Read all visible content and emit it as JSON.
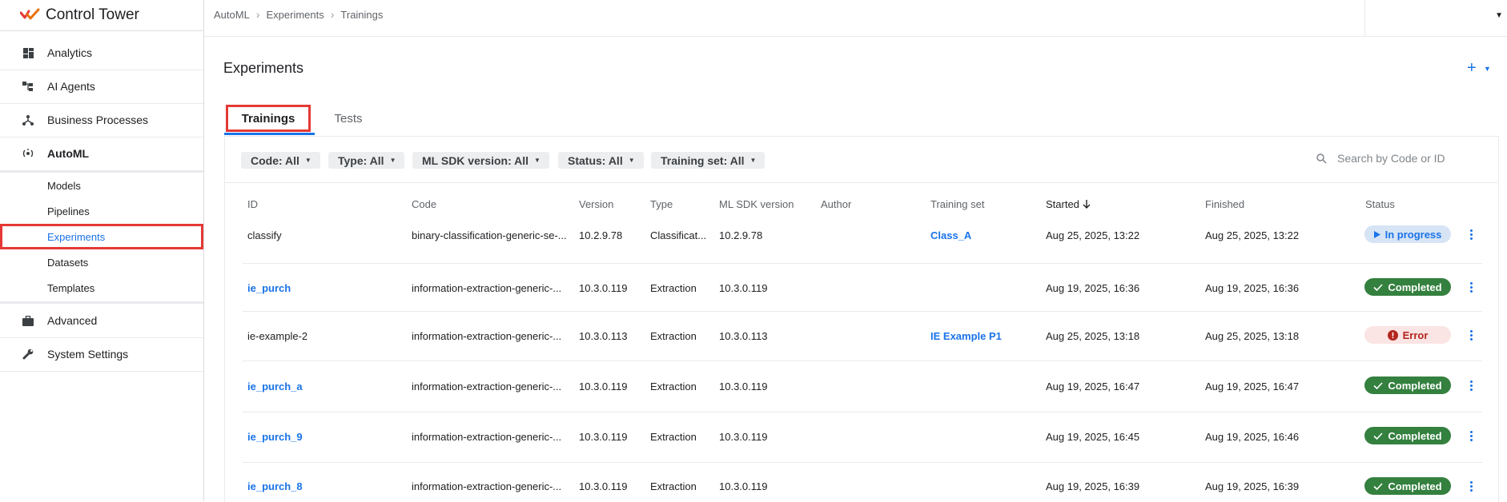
{
  "app": {
    "title": "Control Tower"
  },
  "sidebar": {
    "items": [
      {
        "label": "Analytics",
        "icon": "dashboard-icon"
      },
      {
        "label": "AI Agents",
        "icon": "agents-icon"
      },
      {
        "label": "Business Processes",
        "icon": "process-icon"
      },
      {
        "label": "AutoML",
        "icon": "automl-icon"
      }
    ],
    "automl_sub": [
      {
        "label": "Models"
      },
      {
        "label": "Pipelines"
      },
      {
        "label": "Experiments"
      },
      {
        "label": "Datasets"
      },
      {
        "label": "Templates"
      }
    ],
    "bottom_items": [
      {
        "label": "Advanced",
        "icon": "briefcase-icon"
      },
      {
        "label": "System Settings",
        "icon": "wrench-icon"
      }
    ]
  },
  "breadcrumb": [
    "AutoML",
    "Experiments",
    "Trainings"
  ],
  "page": {
    "title": "Experiments",
    "add_label": "+"
  },
  "tabs": [
    {
      "label": "Trainings"
    },
    {
      "label": "Tests"
    }
  ],
  "filters": [
    {
      "label": "Code: All"
    },
    {
      "label": "Type: All"
    },
    {
      "label": "ML SDK version: All"
    },
    {
      "label": "Status: All"
    },
    {
      "label": "Training set: All"
    }
  ],
  "search": {
    "placeholder": "Search by Code or ID"
  },
  "table": {
    "columns": [
      "ID",
      "Code",
      "Version",
      "Type",
      "ML SDK version",
      "Author",
      "Training set",
      "Started",
      "Finished",
      "Status"
    ],
    "rows": [
      {
        "id": "classify",
        "code": "binary-classification-generic-se-...",
        "version": "10.2.9.78",
        "type": "Classificat...",
        "sdk": "10.2.9.78",
        "author": "",
        "training_set": "Class_A",
        "started": "Aug 25, 2025, 13:22",
        "finished": "Aug 25, 2025, 13:22",
        "status": "In progress"
      },
      {
        "id": "ie_purch",
        "code": "information-extraction-generic-...",
        "version": "10.3.0.119",
        "type": "Extraction",
        "sdk": "10.3.0.119",
        "author": "",
        "training_set": "",
        "started": "Aug 19, 2025, 16:36",
        "finished": "Aug 19, 2025, 16:36",
        "status": "Completed"
      },
      {
        "id": "ie-example-2",
        "code": "information-extraction-generic-...",
        "version": "10.3.0.113",
        "type": "Extraction",
        "sdk": "10.3.0.113",
        "author": "",
        "training_set": "IE Example P1",
        "started": "Aug 25, 2025, 13:18",
        "finished": "Aug 25, 2025, 13:18",
        "status": "Error"
      },
      {
        "id": "ie_purch_a",
        "code": "information-extraction-generic-...",
        "version": "10.3.0.119",
        "type": "Extraction",
        "sdk": "10.3.0.119",
        "author": "",
        "training_set": "",
        "started": "Aug 19, 2025, 16:47",
        "finished": "Aug 19, 2025, 16:47",
        "status": "Completed"
      },
      {
        "id": "ie_purch_9",
        "code": "information-extraction-generic-...",
        "version": "10.3.0.119",
        "type": "Extraction",
        "sdk": "10.3.0.119",
        "author": "",
        "training_set": "",
        "started": "Aug 19, 2025, 16:45",
        "finished": "Aug 19, 2025, 16:46",
        "status": "Completed"
      },
      {
        "id": "ie_purch_8",
        "code": "information-extraction-generic-...",
        "version": "10.3.0.119",
        "type": "Extraction",
        "sdk": "10.3.0.119",
        "author": "",
        "training_set": "",
        "started": "Aug 19, 2025, 16:39",
        "finished": "Aug 19, 2025, 16:39",
        "status": "Completed"
      }
    ]
  },
  "colors": {
    "accent": "#1a73e8",
    "highlight": "#e53935",
    "completed": "#34803f",
    "error": "#b3261e"
  }
}
